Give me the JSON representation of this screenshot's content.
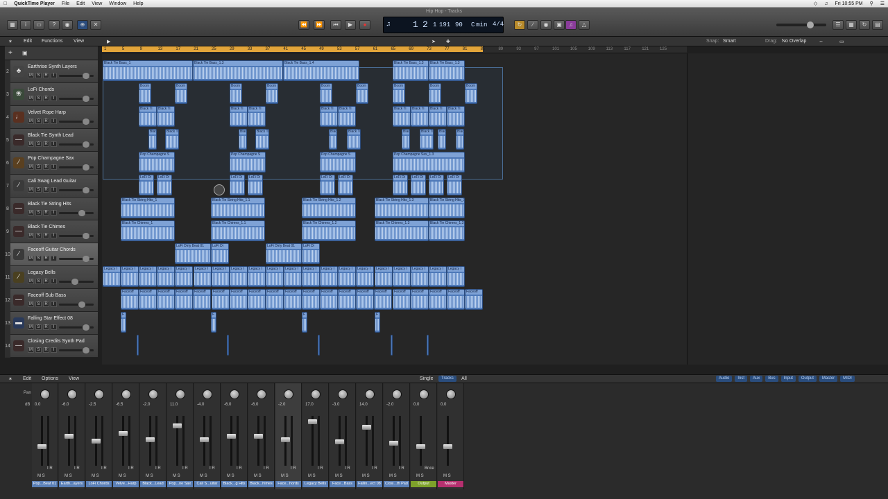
{
  "menubar": {
    "app": "QuickTime Player",
    "items": [
      "File",
      "Edit",
      "View",
      "Window",
      "Help"
    ],
    "clock": "Fri 10:55 PM"
  },
  "window": {
    "title": "Hip Hop - Tracks"
  },
  "lcd": {
    "bar": "1",
    "beat": "2",
    "div": "1",
    "tick": "191",
    "tempo": "90",
    "key": "C min",
    "signature": "4/4"
  },
  "toolbar": {
    "edit": "Edit",
    "functions": "Functions",
    "view": "View",
    "snap_label": "Snap:",
    "snap_value": "Smart",
    "drag_label": "Drag:",
    "drag_value": "No Overlap"
  },
  "ruler": {
    "marks": [
      "1",
      "5",
      "9",
      "13",
      "17",
      "21",
      "25",
      "29",
      "33",
      "37",
      "41",
      "45",
      "49",
      "53",
      "57",
      "61",
      "65",
      "69",
      "73",
      "77",
      "81",
      "85",
      "89",
      "93",
      "97",
      "101",
      "105",
      "109",
      "113",
      "117",
      "121",
      "125"
    ]
  },
  "tracks": [
    {
      "num": "2",
      "name": "Earthrise Synth Layers"
    },
    {
      "num": "3",
      "name": "LoFi Chords"
    },
    {
      "num": "4",
      "name": "Velvet Rope Harp"
    },
    {
      "num": "5",
      "name": "Black Tie Synth Lead"
    },
    {
      "num": "6",
      "name": "Pop Champagne Sax"
    },
    {
      "num": "7",
      "name": "Cali Swag Lead Guitar"
    },
    {
      "num": "8",
      "name": "Black Tie String Hits"
    },
    {
      "num": "9",
      "name": "Black Tie Chimes"
    },
    {
      "num": "10",
      "name": "Faceoff Guitar Chords"
    },
    {
      "num": "11",
      "name": "Legacy Bells"
    },
    {
      "num": "12",
      "name": "Faceoff Sub Bass"
    },
    {
      "num": "13",
      "name": "Falling Star Effect 08"
    },
    {
      "num": "14",
      "name": "Closing Credits Synth Pad"
    }
  ],
  "track_buttons": [
    "M",
    "S",
    "R",
    "I"
  ],
  "region_labels": {
    "bass1": "Black Tie Bass_1",
    "bass13": "Black Tie Bass_1.3",
    "bass14": "Black Tie Bass_1.4",
    "boom": "Boom",
    "bt": "Black Ti",
    "pop": "Pop Champagne S",
    "pop13": "Pop Champagne Sax_1.3",
    "lofidi": "LoFi Di",
    "sh1": "Black Tie String Hits_1",
    "sh11": "Black Tie String Hits_1.1",
    "sh12": "Black Tie String Hits_1.2",
    "sh13": "Black Tie String Hits_1.3",
    "ch1": "Black Tie Chimes_1",
    "ch11": "Black Tie Chimes_1.1",
    "ch12": "Black Tie Chimes_1.2",
    "ch13": "Black Tie Chimes_1.3",
    "dirty": "LoFi Dirty Beat 01",
    "legacy": "Legacy I",
    "faceoff": "Faceoff",
    "f": "F"
  },
  "mixer": {
    "menu": [
      "Edit",
      "Options",
      "View"
    ],
    "view_modes": [
      "Single",
      "Tracks",
      "All"
    ],
    "filters": [
      "Audio",
      "Inst",
      "Aux",
      "Bus",
      "Input",
      "Output",
      "Master",
      "MIDI"
    ],
    "pan_label": "Pan",
    "db_label": "dB",
    "strips": [
      {
        "name": "Pop...Beat 01",
        "db": "0.0"
      },
      {
        "name": "Earth...ayers",
        "db": "-6.0"
      },
      {
        "name": "LoFi Chords",
        "db": "-2.5"
      },
      {
        "name": "Velve...Harp",
        "db": "-6.5"
      },
      {
        "name": "Black...Lead",
        "db": "-2.0"
      },
      {
        "name": "Pop...ne Sax",
        "db": "11.0"
      },
      {
        "name": "Cali S...uitar",
        "db": "-4.0"
      },
      {
        "name": "Black...g Hits",
        "db": "-6.0"
      },
      {
        "name": "Black...himes",
        "db": "-6.0"
      },
      {
        "name": "Face...hords",
        "db": "-2.0"
      },
      {
        "name": "Legacy Bells",
        "db": "17.0"
      },
      {
        "name": "Face...Bass",
        "db": "-3.0"
      },
      {
        "name": "Fallin...ect 08",
        "db": "14.0"
      },
      {
        "name": "Closi...th Pad",
        "db": "-2.0"
      },
      {
        "name": "Output",
        "db": "0.0"
      },
      {
        "name": "Master",
        "db": "0.0"
      }
    ],
    "bnce": "Bnce",
    "io": "I R",
    "ms": "M S"
  }
}
